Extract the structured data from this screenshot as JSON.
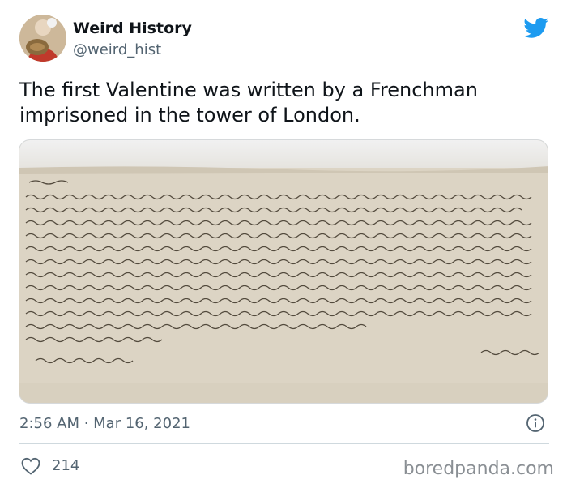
{
  "tweet": {
    "author_name": "Weird History",
    "author_handle": "@weird_hist",
    "text": "The first Valentine was written by a Frenchman imprisoned in the tower of London.",
    "timestamp": "2:56 AM · Mar 16, 2021",
    "like_count": "214"
  },
  "watermark": "boredpanda.com",
  "icons": {
    "platform": "twitter-bird-icon",
    "info": "info-icon",
    "like": "heart-icon"
  },
  "colors": {
    "brand": "#1d9bf0",
    "text_primary": "#0f1419",
    "text_secondary": "#536471",
    "divider": "#cfd9de"
  }
}
